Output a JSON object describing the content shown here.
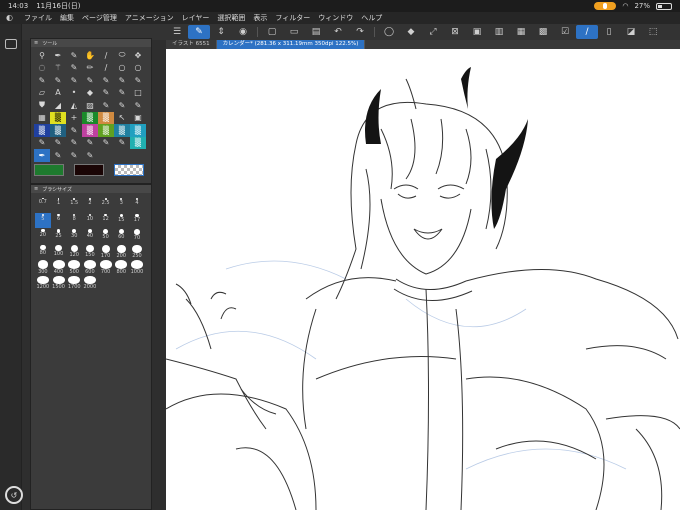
{
  "status": {
    "time": "14:03",
    "date": "11月16日(日)",
    "battery": "27%"
  },
  "menu": [
    "ファイル",
    "編集",
    "ページ管理",
    "アニメーション",
    "レイヤー",
    "選択範囲",
    "表示",
    "フィルター",
    "ウィンドウ",
    "ヘルプ"
  ],
  "tabs": [
    {
      "label": "イラスト 6551"
    },
    {
      "label": "カレンダー* (281.36 x 311.19mm 350dpi 122.5%)"
    }
  ],
  "tool_panel": {
    "title": "ツール"
  },
  "brush_panel": {
    "title": "ブラシサイズ",
    "sizes": [
      "0.7",
      "1",
      "1.5",
      "2",
      "2.5",
      "3",
      "4",
      "5",
      "6",
      "8",
      "10",
      "12",
      "15",
      "17",
      "20",
      "25",
      "30",
      "40",
      "50",
      "60",
      "70",
      "80",
      "100",
      "120",
      "150",
      "170",
      "200",
      "250",
      "300",
      "400",
      "500",
      "600",
      "700",
      "800",
      "1000",
      "1200",
      "1500",
      "1700",
      "2000"
    ]
  },
  "colors": {
    "main": "#1e7a2e",
    "sub": "#1a0505",
    "transparent": "checker",
    "accent": "#2d72c4"
  }
}
